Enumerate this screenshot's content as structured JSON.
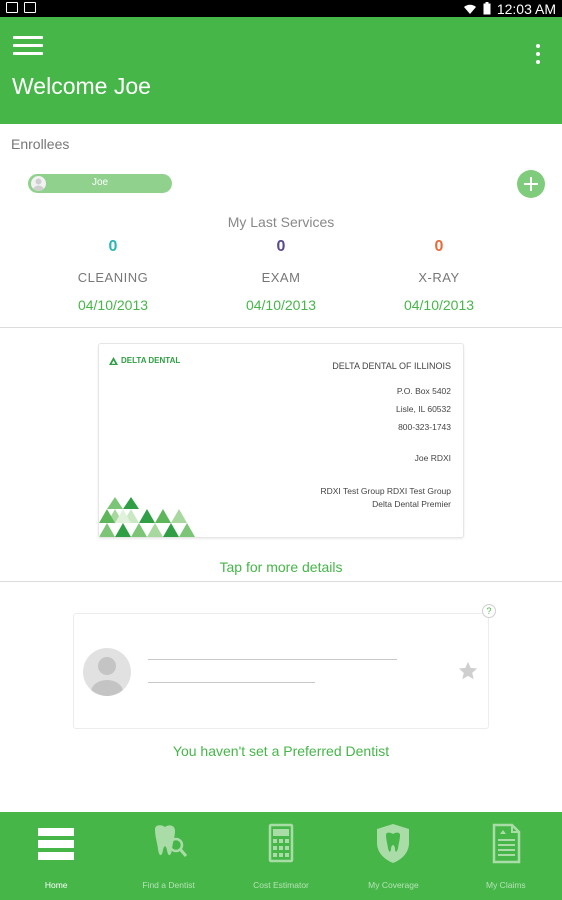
{
  "status_bar": {
    "time": "12:03 AM"
  },
  "header": {
    "title": "Welcome Joe"
  },
  "enrollees": {
    "label": "Enrollees",
    "items": [
      {
        "name": "Joe"
      }
    ]
  },
  "services": {
    "title": "My Last Services",
    "items": [
      {
        "count": "0",
        "label": "CLEANING",
        "date": "04/10/2013",
        "color": "#29b7b7"
      },
      {
        "count": "0",
        "label": "EXAM",
        "date": "04/10/2013",
        "color": "#5b4a8e"
      },
      {
        "count": "0",
        "label": "X-RAY",
        "date": "04/10/2013",
        "color": "#ea6a3a"
      }
    ]
  },
  "id_card": {
    "logo": "DELTA DENTAL",
    "company": "DELTA DENTAL OF ILLINOIS",
    "po_box": "P.O. Box 5402",
    "city": "Lisle, IL 60532",
    "phone": "800-323-1743",
    "member": "Joe RDXI",
    "group": "RDXI Test Group RDXI Test Group",
    "plan": "Delta Dental Premier"
  },
  "tap_details": "Tap for more details",
  "preferred_dentist": {
    "help": "?",
    "empty_message": "You haven't set a Preferred Dentist"
  },
  "bottom_nav": [
    {
      "label": "Home",
      "icon": "home-list-icon",
      "active": true
    },
    {
      "label": "Find a Dentist",
      "icon": "tooth-search-icon",
      "active": false
    },
    {
      "label": "Cost Estimator",
      "icon": "calculator-icon",
      "active": false
    },
    {
      "label": "My Coverage",
      "icon": "tooth-shield-icon",
      "active": false
    },
    {
      "label": "My Claims",
      "icon": "claims-document-icon",
      "active": false
    }
  ],
  "colors": {
    "brand_green": "#46b649",
    "accent_green": "#8fd18d"
  }
}
